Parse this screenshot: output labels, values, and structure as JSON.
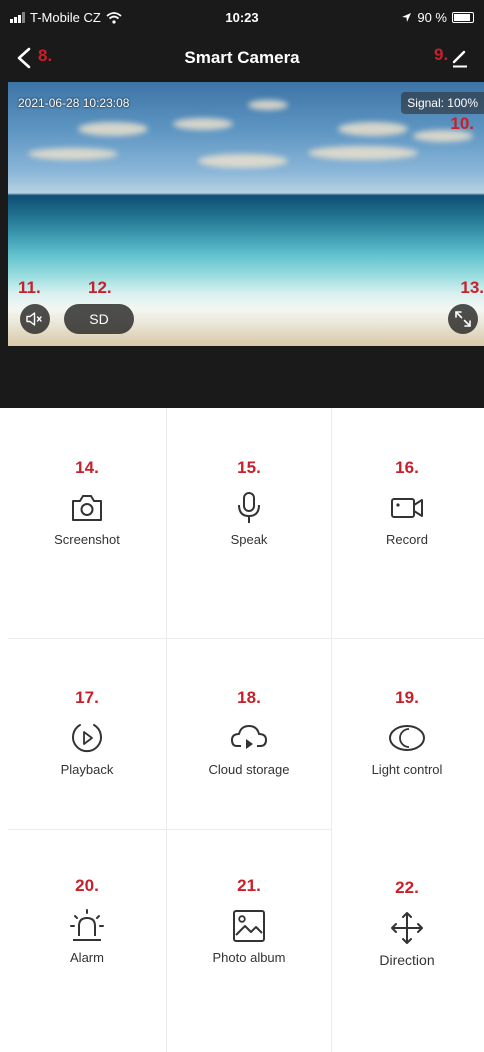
{
  "status_bar": {
    "carrier": "T-Mobile CZ",
    "time": "10:23",
    "battery": "90 %"
  },
  "header": {
    "title": "Smart Camera",
    "back_marker": "8.",
    "edit_marker": "9."
  },
  "camera": {
    "timestamp": "2021-06-28 10:23:08",
    "signal": "Signal: 100%",
    "signal_marker": "10.",
    "mute_marker": "11.",
    "quality_label": "SD",
    "quality_marker": "12.",
    "fullscreen_marker": "13."
  },
  "functions": [
    {
      "number": "14.",
      "label": "Screenshot",
      "icon": "camera-icon"
    },
    {
      "number": "15.",
      "label": "Speak",
      "icon": "microphone-icon"
    },
    {
      "number": "16.",
      "label": "Record",
      "icon": "video-icon"
    },
    {
      "number": "17.",
      "label": "Playback",
      "icon": "playback-icon"
    },
    {
      "number": "18.",
      "label": "Cloud storage",
      "icon": "cloud-play-icon"
    },
    {
      "number": "19.",
      "label": "Light control",
      "icon": "moon-icon"
    },
    {
      "number": "20.",
      "label": "Alarm",
      "icon": "siren-icon"
    },
    {
      "number": "21.",
      "label": "Photo album",
      "icon": "image-icon"
    },
    {
      "number": "22.",
      "label": "Direction",
      "icon": "move-arrows-icon"
    }
  ],
  "colors": {
    "accent": "#c8202a",
    "dark_background": "#1a1a1a"
  }
}
